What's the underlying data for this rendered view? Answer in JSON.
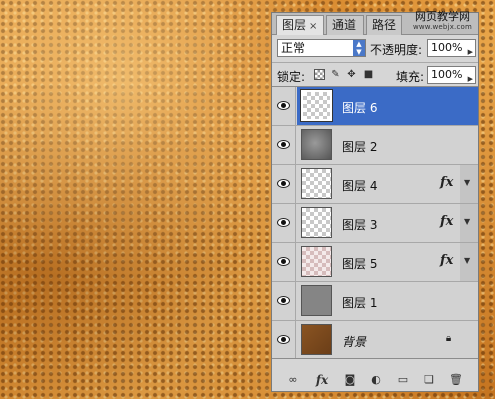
{
  "panel": {
    "tabs": [
      {
        "label": "图层",
        "close": "×"
      },
      {
        "label": "通道"
      },
      {
        "label": "路径"
      }
    ],
    "watermark": {
      "line1": "网页教学网",
      "line2": "www.webjx.com"
    },
    "blend_mode": "正常",
    "opacity_label": "不透明度:",
    "opacity_value": "100%",
    "lock_label": "锁定:",
    "fill_label": "填充:",
    "fill_value": "100%",
    "fx_label": "fx",
    "layers": [
      {
        "name": "图层 6",
        "selected": true,
        "thumb": "checker",
        "fx": false
      },
      {
        "name": "图层 2",
        "selected": false,
        "thumb": "gray-shade",
        "fx": false
      },
      {
        "name": "图层 4",
        "selected": false,
        "thumb": "checker",
        "fx": true
      },
      {
        "name": "图层 3",
        "selected": false,
        "thumb": "checker",
        "fx": true
      },
      {
        "name": "图层 5",
        "selected": false,
        "thumb": "checker-pink",
        "fx": true
      },
      {
        "name": "图层 1",
        "selected": false,
        "thumb": "gray-flat",
        "fx": false
      },
      {
        "name": "背景",
        "selected": false,
        "thumb": "brown",
        "fx": false,
        "locked": true
      }
    ],
    "footer_icons": [
      "link-icon",
      "fx-icon",
      "mask-icon",
      "adjustment-icon",
      "folder-icon",
      "new-layer-icon",
      "trash-icon"
    ]
  },
  "colors": {
    "selection": "#3b6bc6",
    "panel_bg": "#d6d6d6",
    "canvas": "#d8892e"
  }
}
